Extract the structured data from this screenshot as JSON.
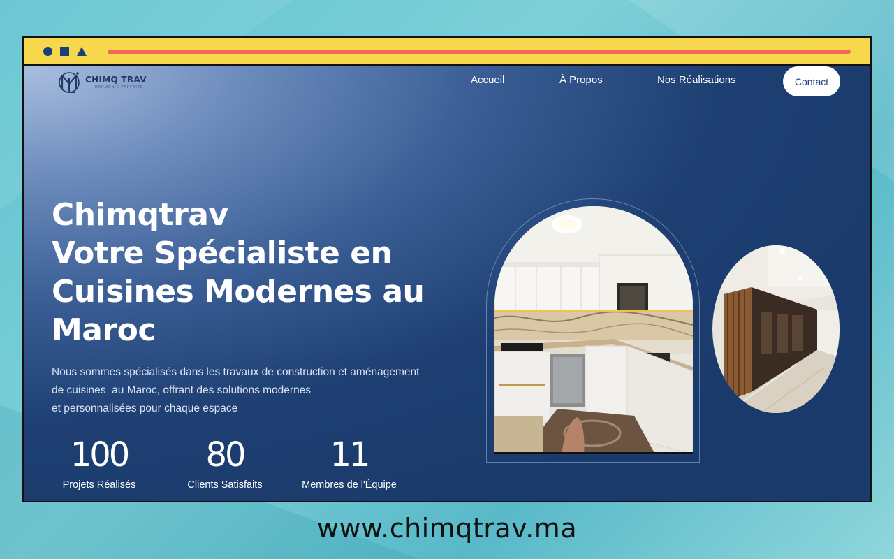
{
  "brand": {
    "name": "CHIMQ TRAV",
    "tagline": "HARMONIE PARFAITE"
  },
  "nav": {
    "items": [
      {
        "label": "Accueil"
      },
      {
        "label": "À Propos"
      },
      {
        "label": "Nos Réalisations"
      }
    ],
    "contact_label": "Contact"
  },
  "hero": {
    "title_lines": [
      "Chimqtrav",
      "Votre Spécialiste en",
      "Cuisines Modernes au",
      "Maroc"
    ],
    "description_lines": [
      "Nous sommes spécialisés dans les travaux de construction et aménagement",
      "de cuisines  au Maroc, offrant des solutions modernes",
      "et personnalisées pour chaque espace"
    ]
  },
  "stats": [
    {
      "value": "100",
      "label": "Projets Réalisés"
    },
    {
      "value": "80",
      "label": "Clients Satisfaits"
    },
    {
      "value": "11",
      "label": "Membres de l'Équipe"
    }
  ],
  "footer_url": "www.chimqtrav.ma",
  "colors": {
    "window_chrome": "#f7d84c",
    "chrome_bar": "#f2665e",
    "chrome_icons": "#1d3e78",
    "site_background": "#1a3a6b",
    "contact_button": "#ffffff"
  },
  "icons": {
    "chrome_controls": [
      "circle-icon",
      "square-icon",
      "triangle-icon"
    ],
    "logo": "ml-monogram-logo-icon"
  }
}
